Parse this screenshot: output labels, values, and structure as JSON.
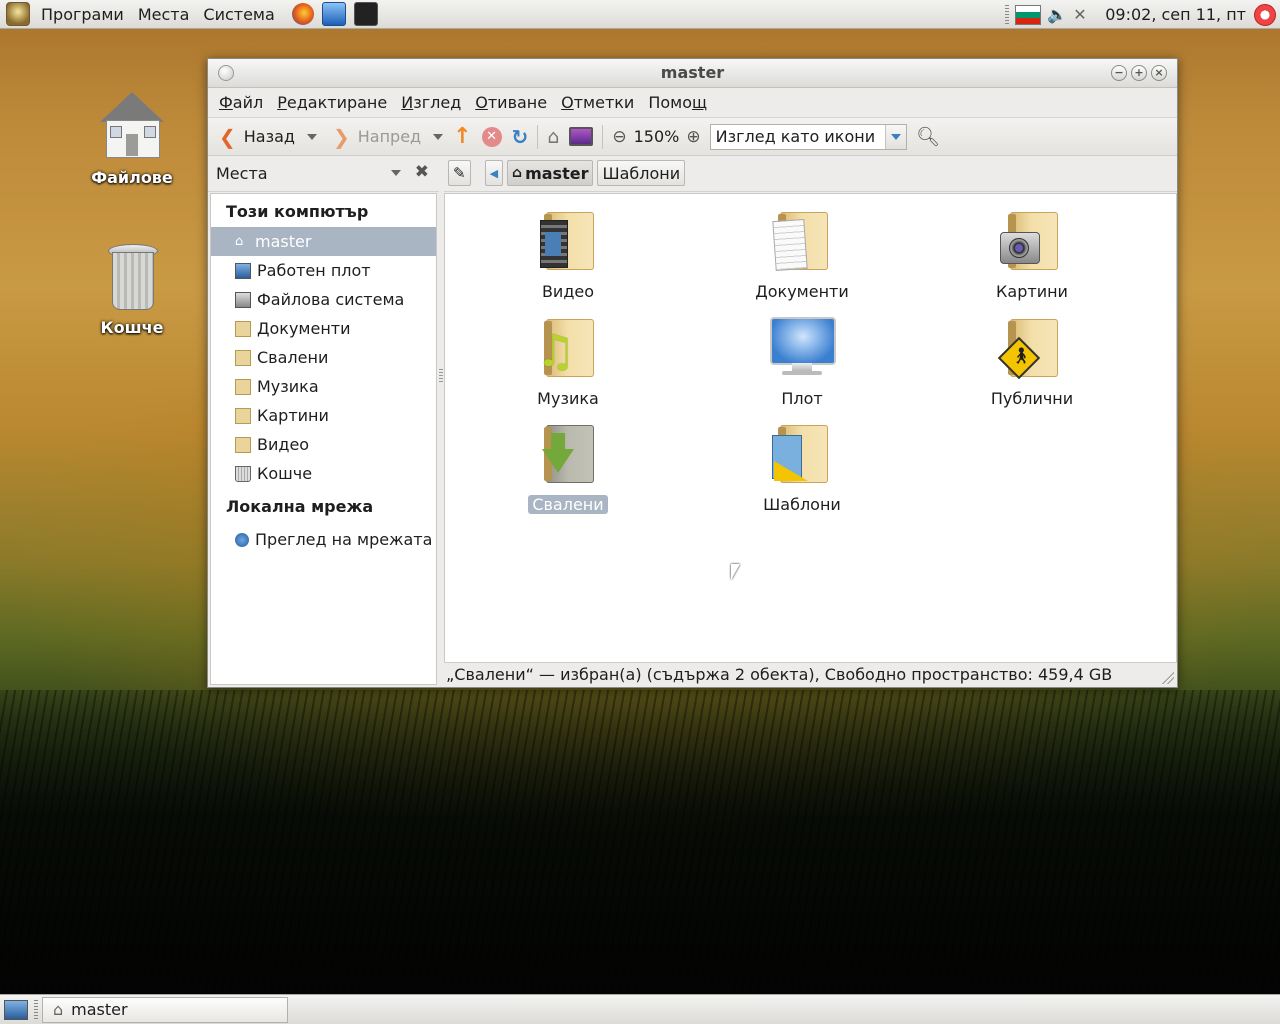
{
  "top_panel": {
    "menus": [
      "Програми",
      "Места",
      "Система"
    ],
    "clock": "09:02, сеп 11, пт"
  },
  "desktop": {
    "icons": [
      {
        "label": "Файлове"
      },
      {
        "label": "Кошче"
      }
    ]
  },
  "window": {
    "title": "master",
    "menubar": {
      "file": {
        "mnemonic": "Ф",
        "rest": "айл"
      },
      "edit": {
        "mnemonic": "Р",
        "rest": "едактиране"
      },
      "view": {
        "mnemonic": "И",
        "rest": "зглед"
      },
      "go": {
        "mnemonic": "О",
        "rest": "тиване"
      },
      "bookmarks": {
        "mnemonic": "О",
        "rest": "тметки"
      },
      "help": {
        "pre": "Помо",
        "mnemonic": "щ"
      }
    },
    "toolbar": {
      "back": "Назад",
      "forward": "Напред",
      "zoom": "150%",
      "view_mode": "Изглед като икони"
    },
    "sidebar": {
      "header": "Места",
      "sections": [
        {
          "title": "Този компютър",
          "items": [
            "master",
            "Работен плот",
            "Файлова система",
            "Документи",
            "Свалени",
            "Музика",
            "Картини",
            "Видео",
            "Кошче"
          ]
        },
        {
          "title": "Локална мрежа",
          "items": [
            "Преглед на мрежата"
          ]
        }
      ],
      "selected": "master"
    },
    "pathbar": {
      "current": "master",
      "next": "Шаблони"
    },
    "files": [
      "Видео",
      "Документи",
      "Картини",
      "Музика",
      "Плот",
      "Публични",
      "Свалени",
      "Шаблони"
    ],
    "selected_file": "Свалени",
    "status": "„Свалени“ — избран(а) (съдържа 2 обекта), Свободно пространство: 459,4 GB"
  },
  "bottom_panel": {
    "task": "master"
  },
  "colors": {
    "selection": "#a9b5c2",
    "panel": "#e6e5e1"
  }
}
